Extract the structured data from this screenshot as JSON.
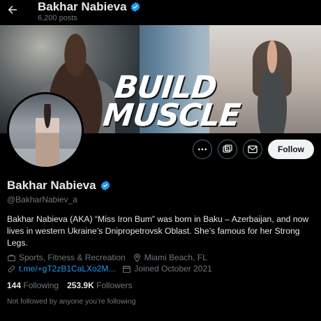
{
  "header": {
    "title": "Bakhar Nabieva",
    "posts_count": "6,200 posts"
  },
  "banner": {
    "headline_line1": "BUILD",
    "headline_line2": "MUSCLE"
  },
  "actions": {
    "follow_label": "Follow"
  },
  "profile": {
    "name": "Bakhar Nabieva",
    "handle": "@BakharNabiev_a",
    "bio": "Bakhar Nabieva (AKA) “Miss Iron Bum” was born in Baku – Azerbaijan, and now lives in western Ukraine’s Dnipropetrovsk Oblast. She’s famous for her Strong Legs.",
    "category": "Sports, Fitness & Recreation",
    "location": "Miami Beach, FL",
    "link": "t.me/+gT2zB1CaLXo2M...",
    "joined": "Joined October 2021"
  },
  "stats": {
    "following_count": "144",
    "following_label": "Following",
    "followers_count": "253.9K",
    "followers_label": "Followers"
  },
  "note": "Not followed by anyone you’re following",
  "colors": {
    "verified": "#1d9bf0",
    "link": "#1d9bf0",
    "muted": "#71767b",
    "text": "#e7e9ea",
    "follow_bg": "#eff3f4"
  }
}
